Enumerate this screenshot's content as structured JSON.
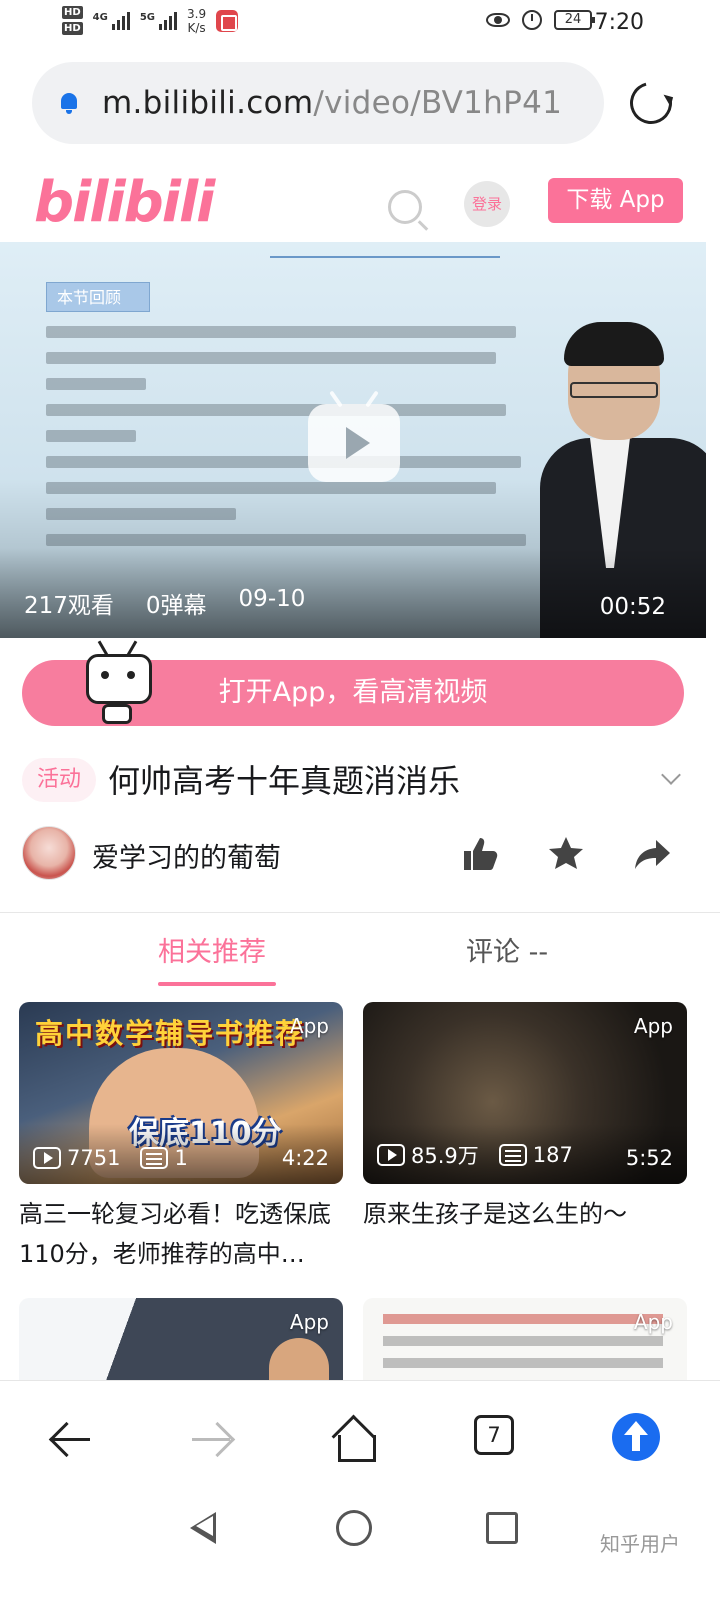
{
  "status_bar": {
    "hd1": "HD",
    "hd2": "HD",
    "net1": "4G",
    "net2": "5G",
    "speed_value": "3.9",
    "speed_unit": "K/s",
    "battery": "24",
    "time": "7:20"
  },
  "browser": {
    "url_host": "m.bilibili.com",
    "url_path": "/video/BV1hP41",
    "tab_count": "7"
  },
  "site_header": {
    "logo": "bilibili",
    "login_label": "登录",
    "download_label": "下载 App",
    "brand_color": "#fb7299"
  },
  "video": {
    "slide_title": "本节回顾",
    "views": "217观看",
    "danmaku": "0弹幕",
    "date": "09-10",
    "duration": "00:52"
  },
  "open_app_banner": {
    "label": "打开App，看高清视频"
  },
  "video_info": {
    "tag": "活动",
    "title": "何帅高考十年真题消消乐",
    "uploader": "爱学习的的葡萄"
  },
  "tabs": [
    {
      "label": "相关推荐",
      "active": true
    },
    {
      "label": "评论 --",
      "active": false
    }
  ],
  "recommendations": [
    {
      "app_badge": "App",
      "thumb_text": "高中数学辅导书推荐",
      "thumb_big": "保底110分",
      "plays": "7751",
      "danmaku": "1",
      "duration": "4:22",
      "title": "高三一轮复习必看！吃透保底110分，老师推荐的高中…"
    },
    {
      "app_badge": "App",
      "plays": "85.9万",
      "danmaku": "187",
      "duration": "5:52",
      "title": "原来生孩子是这么生的～"
    },
    {
      "app_badge": "App"
    },
    {
      "app_badge": "App"
    }
  ],
  "watermark": "知乎用户"
}
